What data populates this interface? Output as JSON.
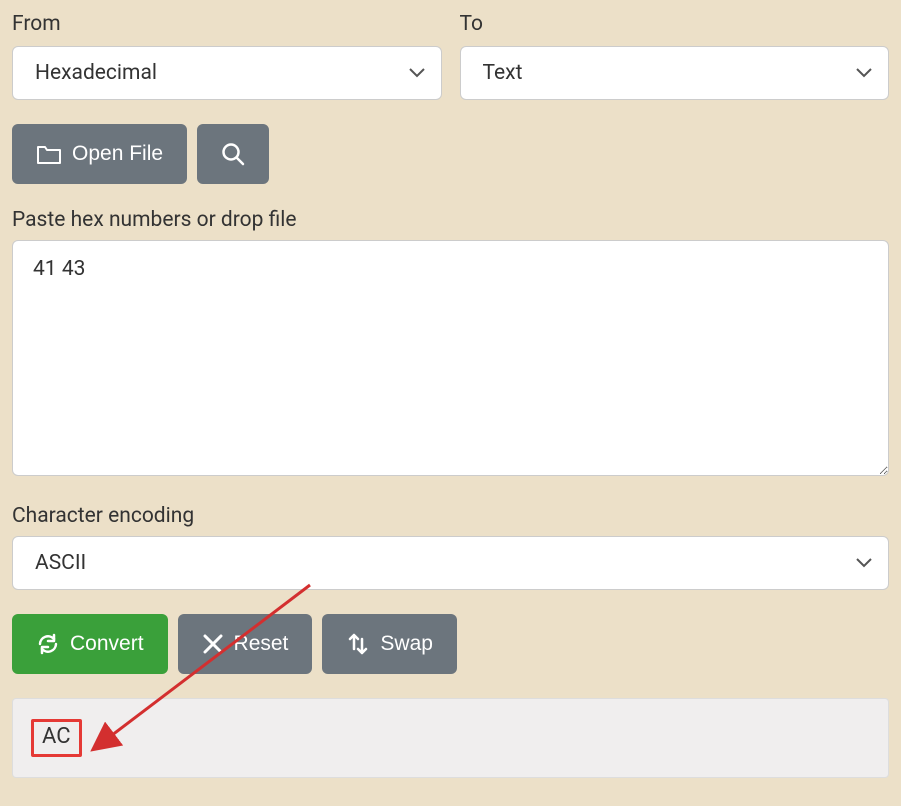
{
  "from": {
    "label": "From",
    "selected": "Hexadecimal"
  },
  "to": {
    "label": "To",
    "selected": "Text"
  },
  "open_file_label": "Open File",
  "input": {
    "label": "Paste hex numbers or drop file",
    "value": "41 43"
  },
  "encoding": {
    "label": "Character encoding",
    "selected": "ASCII"
  },
  "buttons": {
    "convert": "Convert",
    "reset": "Reset",
    "swap": "Swap"
  },
  "output": {
    "value": "AC"
  },
  "colors": {
    "bg": "#ece0c8",
    "gray": "#6c757d",
    "green": "#3aa03a",
    "highlight": "#e53935"
  }
}
